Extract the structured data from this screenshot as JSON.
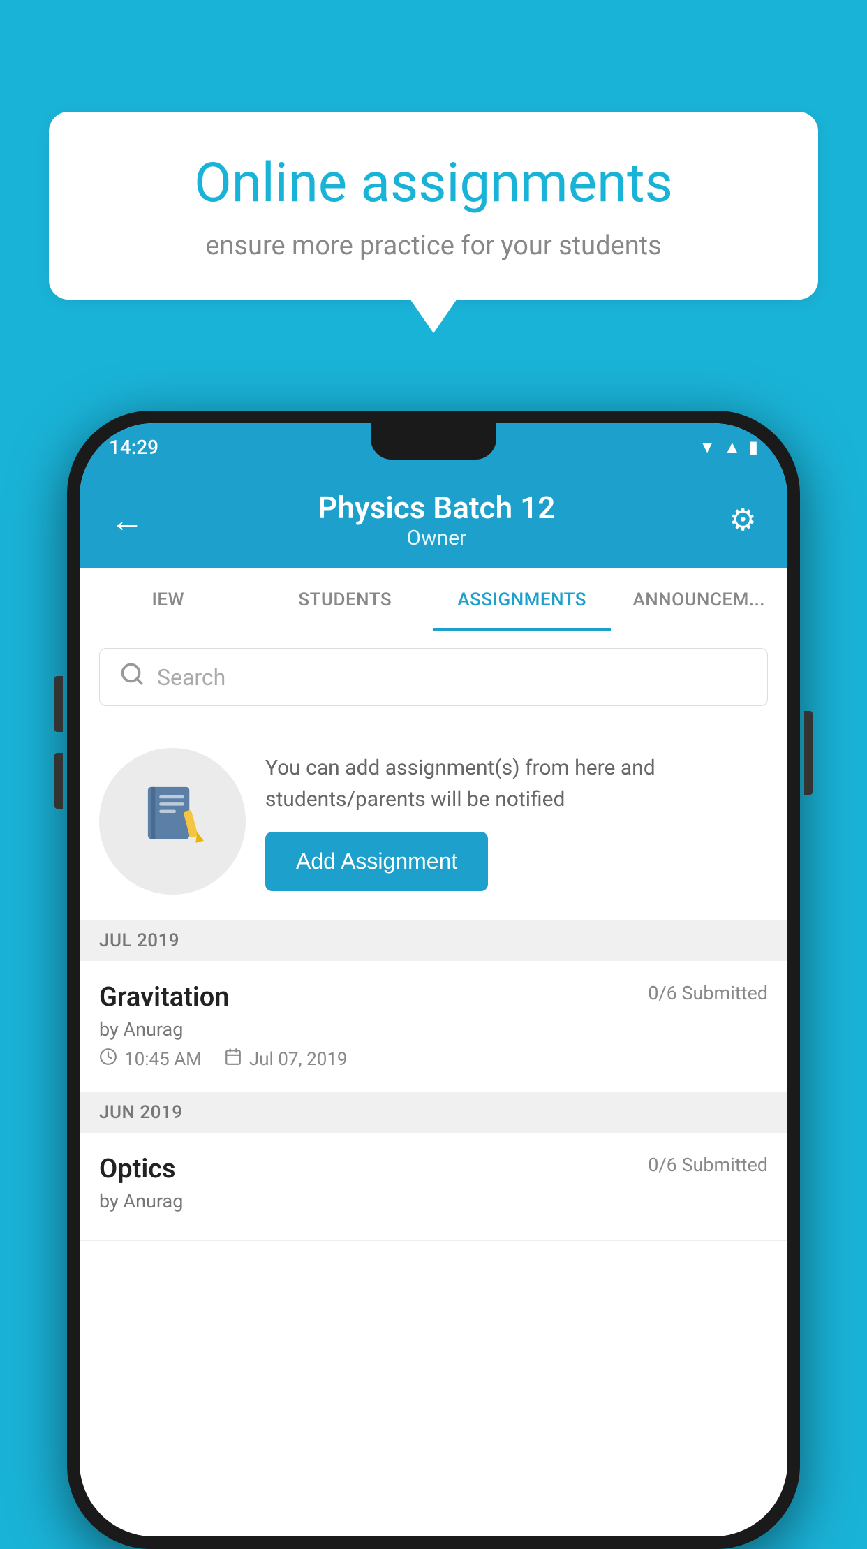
{
  "background_color": "#1ab3d8",
  "speech_bubble": {
    "title": "Online assignments",
    "subtitle": "ensure more practice for your students"
  },
  "status_bar": {
    "time": "14:29",
    "icons": [
      "wifi",
      "signal",
      "battery"
    ]
  },
  "app_header": {
    "title": "Physics Batch 12",
    "subtitle": "Owner",
    "back_label": "←",
    "settings_label": "⚙"
  },
  "tabs": [
    {
      "id": "view",
      "label": "IEW"
    },
    {
      "id": "students",
      "label": "STUDENTS"
    },
    {
      "id": "assignments",
      "label": "ASSIGNMENTS",
      "active": true
    },
    {
      "id": "announcements",
      "label": "ANNOUNCEM..."
    }
  ],
  "search": {
    "placeholder": "Search"
  },
  "promo": {
    "text": "You can add assignment(s) from here and students/parents will be notified",
    "button_label": "Add Assignment"
  },
  "sections": [
    {
      "month": "JUL 2019",
      "assignments": [
        {
          "title": "Gravitation",
          "submitted": "0/6 Submitted",
          "by": "by Anurag",
          "time": "10:45 AM",
          "date": "Jul 07, 2019"
        }
      ]
    },
    {
      "month": "JUN 2019",
      "assignments": [
        {
          "title": "Optics",
          "submitted": "0/6 Submitted",
          "by": "by Anurag",
          "time": "",
          "date": ""
        }
      ]
    }
  ]
}
